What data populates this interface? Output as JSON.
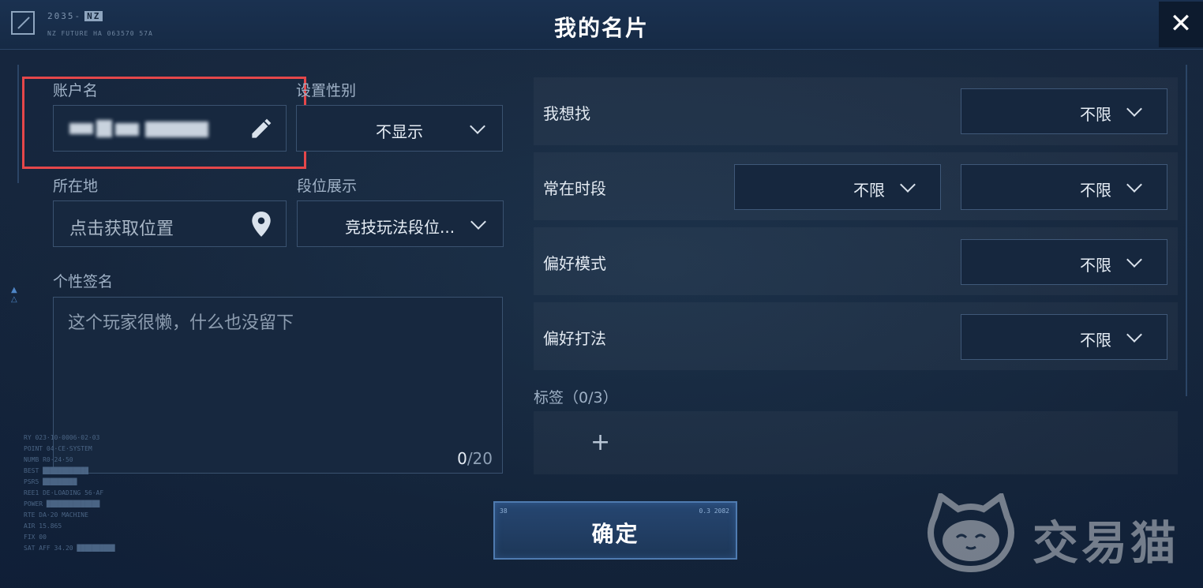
{
  "header": {
    "hud_code": "2035-",
    "hud_tag": "NZ",
    "hud_sub": "NZ FUTURE HA 063570   57A",
    "title": "我的名片",
    "close_icon": "close-icon"
  },
  "left": {
    "account_label": "账户名",
    "gender_label": "设置性别",
    "gender_value": "不显示",
    "location_label": "所在地",
    "location_value": "点击获取位置",
    "rank_label": "段位展示",
    "rank_value": "竞技玩法段位...",
    "signature_label": "个性签名",
    "signature_placeholder": "这个玩家很懒，什么也没留下",
    "signature_count": "0",
    "signature_max": "/20"
  },
  "right": {
    "looking_for_label": "我想找",
    "looking_for_value": "不限",
    "active_time_label": "常在时段",
    "active_time_start": "不限",
    "active_time_end": "不限",
    "pref_mode_label": "偏好模式",
    "pref_mode_value": "不限",
    "pref_style_label": "偏好打法",
    "pref_style_value": "不限",
    "tags_label": "标签（0/3）",
    "add_tag": "+"
  },
  "footer": {
    "confirm_label": "确定",
    "confirm_corner_left": "38",
    "confirm_corner_right": "0.3 2082"
  },
  "watermark": {
    "text": "交易猫"
  },
  "colors": {
    "background": "#13243b",
    "highlight": "#e5474a",
    "accent": "#4f7bb0"
  }
}
